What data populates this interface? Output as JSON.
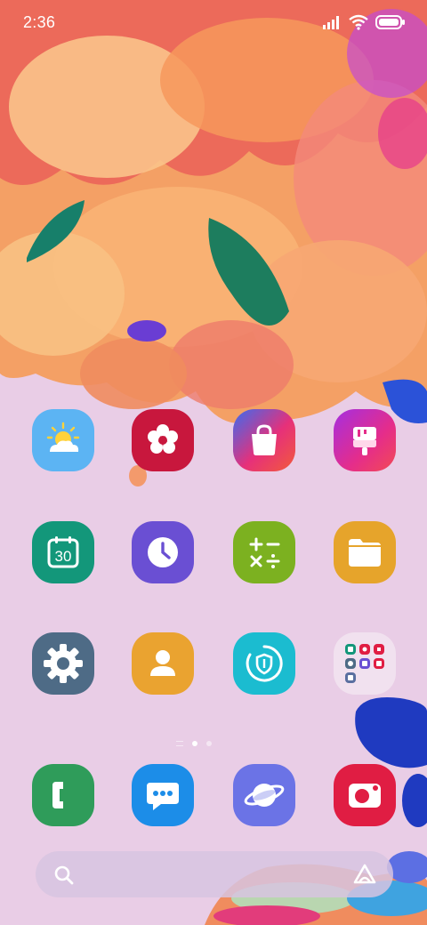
{
  "status_bar": {
    "time": "2:36",
    "icons": [
      "signal-icon",
      "wifi-icon",
      "battery-icon"
    ]
  },
  "home_rows": [
    [
      {
        "name": "weather-app-icon",
        "color": "#5cb4f3"
      },
      {
        "name": "gallery-app-icon",
        "color": "#c8173d"
      },
      {
        "name": "galaxy-store-app-icon",
        "color": "#e6307a"
      },
      {
        "name": "theme-store-app-icon",
        "color": "#e52d8a"
      }
    ],
    [
      {
        "name": "calendar-app-icon",
        "color": "#13977a",
        "text": "30"
      },
      {
        "name": "clock-app-icon",
        "color": "#6a4fd3"
      },
      {
        "name": "calculator-app-icon",
        "color": "#7cb120"
      },
      {
        "name": "my-files-app-icon",
        "color": "#e6a42b"
      }
    ],
    [
      {
        "name": "settings-app-icon",
        "color": "#4e6b86"
      },
      {
        "name": "contacts-app-icon",
        "color": "#eaa330"
      },
      {
        "name": "device-care-app-icon",
        "color": "#1bbcd0"
      },
      {
        "name": "app-folder-icon",
        "color": "#f2e3f0"
      }
    ]
  ],
  "dock": [
    {
      "name": "phone-app-icon",
      "color": "#2f9c5a"
    },
    {
      "name": "messages-app-icon",
      "color": "#1c8de8"
    },
    {
      "name": "internet-app-icon",
      "color": "#6b73e6"
    },
    {
      "name": "camera-app-icon",
      "color": "#e01d43"
    }
  ],
  "pager": {
    "pages": 2,
    "active": 1
  },
  "search": {
    "left_icon": "search-icon",
    "right_icon": "finder-logo-icon"
  }
}
